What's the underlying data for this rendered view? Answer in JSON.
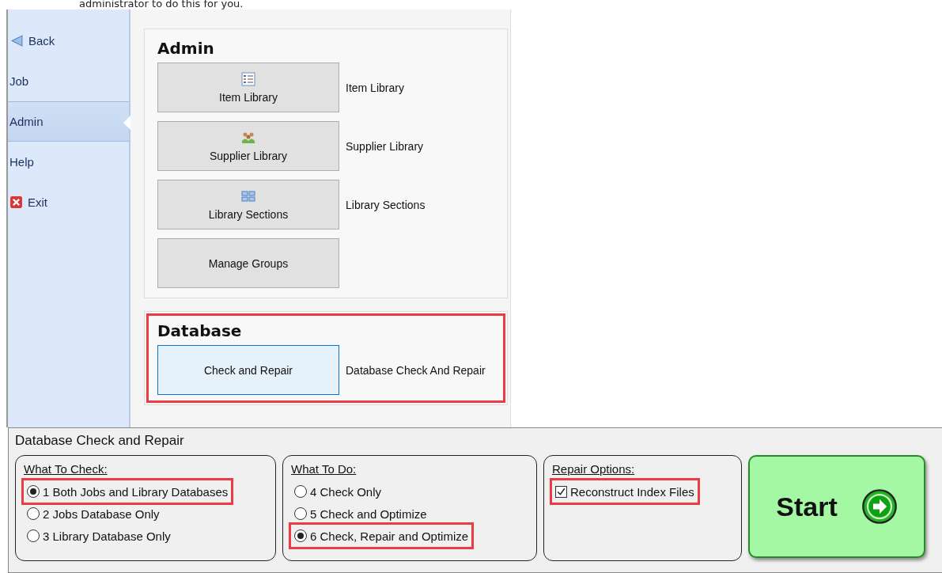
{
  "top_text": "administrator to do this for you.",
  "sidebar": {
    "items": [
      {
        "label": "Back",
        "kind": "back",
        "selected": false
      },
      {
        "label": "Job",
        "kind": "plain",
        "selected": false
      },
      {
        "label": "Admin",
        "kind": "plain",
        "selected": true
      },
      {
        "label": "Help",
        "kind": "plain",
        "selected": false
      },
      {
        "label": "Exit",
        "kind": "exit",
        "selected": false
      }
    ]
  },
  "sections": [
    {
      "title": "Admin",
      "highlighted": false,
      "buttons": [
        {
          "label": "Item Library",
          "kind": "list",
          "description": "Item Library",
          "focused": false
        },
        {
          "label": "Supplier Library",
          "kind": "people",
          "description": "Supplier Library",
          "focused": false
        },
        {
          "label": "Library Sections",
          "kind": "grid",
          "description": "Library Sections",
          "focused": false
        },
        {
          "label": "Manage Groups",
          "kind": "plain",
          "focused": false
        }
      ]
    },
    {
      "title": "Database",
      "highlighted": true,
      "buttons": [
        {
          "label": "Check and Repair",
          "kind": "plain",
          "description": "Database Check And Repair",
          "focused": true
        }
      ]
    }
  ],
  "panel": {
    "title": "Database Check and Repair",
    "groups": [
      {
        "title": "What To Check:",
        "kind": "radio",
        "options": [
          {
            "label": "1 Both Jobs and Library Databases",
            "selected": true,
            "highlighted": true
          },
          {
            "label": "2 Jobs Database Only",
            "selected": false,
            "highlighted": false
          },
          {
            "label": "3 Library Database Only",
            "selected": false,
            "highlighted": false
          }
        ]
      },
      {
        "title": "What To Do:",
        "kind": "radio",
        "options": [
          {
            "label": "4 Check Only",
            "selected": false,
            "highlighted": false
          },
          {
            "label": "5 Check and Optimize",
            "selected": false,
            "highlighted": false
          },
          {
            "label": "6 Check, Repair and Optimize",
            "selected": true,
            "highlighted": true
          }
        ]
      },
      {
        "title": "Repair Options:",
        "kind": "checkbox",
        "options": [
          {
            "label": "Reconstruct Index Files",
            "checked": true,
            "highlighted": true
          }
        ]
      }
    ],
    "start_button": {
      "label": "Start"
    }
  }
}
